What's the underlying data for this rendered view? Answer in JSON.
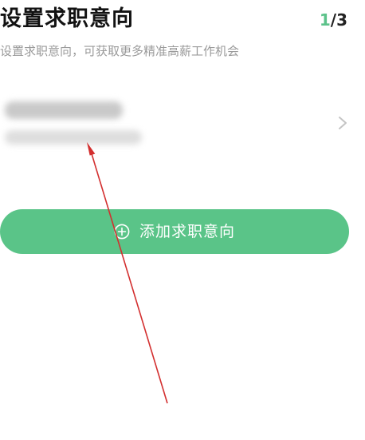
{
  "header": {
    "title": "设置求职意向",
    "step_current": "1",
    "step_total": "/3",
    "subtitle": "设置求职意向，可获取更多精准高薪工作机会"
  },
  "intention_card": {
    "content": "blurred-redacted",
    "chevron_icon": "chevron-right-icon"
  },
  "add_button": {
    "label": "添加求职意向",
    "icon": "plus-circle-icon"
  },
  "colors": {
    "accent": "#5ac488",
    "step_current": "#5cc28a",
    "subtitle": "#9a9a9a",
    "annotation_arrow": "#d32f2f"
  }
}
